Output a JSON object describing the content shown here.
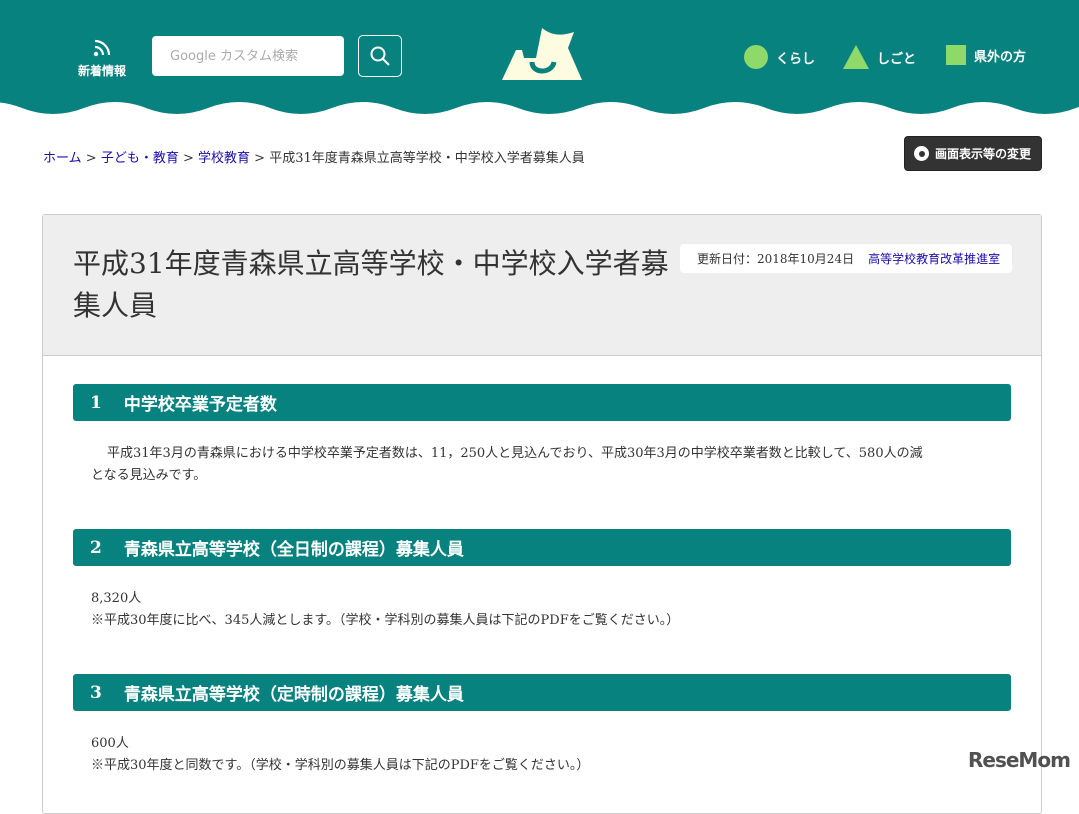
{
  "header": {
    "news_label": "新着情報",
    "search_placeholder": "Google カスタム検索",
    "nav": [
      {
        "label": "くらし",
        "icon": "circle"
      },
      {
        "label": "しごと",
        "icon": "triangle"
      },
      {
        "label": "県外の方",
        "icon": "square"
      }
    ],
    "colors": {
      "teal": "#08827f",
      "green": "#8fd96b"
    }
  },
  "breadcrumb": {
    "items": [
      "ホーム",
      "子ども・教育",
      "学校教育"
    ],
    "separator": ">",
    "current": "平成31年度青森県立高等学校・中学校入学者募集人員"
  },
  "display_button": "画面表示等の変更",
  "page": {
    "title": "平成31年度青森県立高等学校・中学校入学者募集人員",
    "updated": "更新日付：2018年10月24日",
    "department": "高等学校教育改革推進室"
  },
  "sections": [
    {
      "num": "1",
      "heading": "中学校卒業予定者数",
      "lines": [
        "平成31年3月の青森県における中学校卒業予定者数は、11，250人と見込んでおり、平成30年3月の中学校卒業者数と比較して、580人の減",
        "となる見込みです。"
      ]
    },
    {
      "num": "2",
      "heading": "青森県立高等学校（全日制の課程）募集人員",
      "lines": [
        "8,320人",
        "※平成30年度に比べ、345人減とします。（学校・学科別の募集人員は下記のPDFをご覧ください。）"
      ]
    },
    {
      "num": "3",
      "heading": "青森県立高等学校（定時制の課程）募集人員",
      "lines": [
        "600人",
        "※平成30年度と同数です。（学校・学科別の募集人員は下記のPDFをご覧ください。）"
      ]
    }
  ],
  "watermark": "ReseMom"
}
